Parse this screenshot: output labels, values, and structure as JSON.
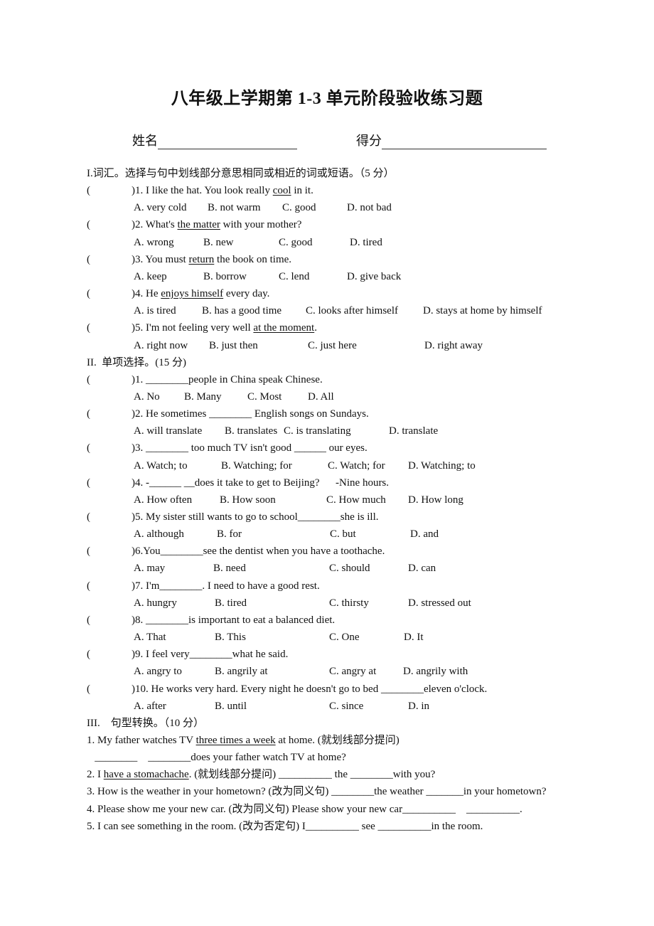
{
  "title": "八年级上学期第 1-3 单元阶段验收练习题",
  "header": {
    "name_label": "姓名",
    "score_label": "得分"
  },
  "section1": {
    "heading": "I.词汇。选择与句中划线部分意思相同或相近的词或短语。（5 分）",
    "questions": [
      {
        "num": ")1. ",
        "pre": "I like the hat. You look really ",
        "u": "cool",
        "post": " in it.",
        "options": [
          "A. very cold",
          "B. not warm",
          "C. good",
          "D. not bad"
        ]
      },
      {
        "num": ")2. ",
        "pre": "What's ",
        "u": "the matter",
        "post": " with your mother?",
        "options": [
          "A. wrong",
          "B. new",
          "C. good",
          "D. tired"
        ]
      },
      {
        "num": ")3. ",
        "pre": "You must ",
        "u": "return",
        "post": " the book on time.",
        "options": [
          "A. keep",
          "B. borrow",
          "C. lend",
          "D. give back"
        ]
      },
      {
        "num": ")4. ",
        "pre": "He ",
        "u": "enjoys himself",
        "post": " every day.",
        "options": [
          "A. is tired",
          "B. has a good time",
          "C. looks after himself",
          "D. stays at home by himself"
        ]
      },
      {
        "num": ")5. ",
        "pre": "I'm not feeling very well ",
        "u": "at the moment",
        "post": ".",
        "options": [
          "A. right now",
          "B. just then",
          "C. just here",
          "D. right away"
        ]
      }
    ]
  },
  "section2": {
    "heading": "II.  单项选择。(15 分)",
    "questions": [
      {
        "text": ")1. ________people in China speak Chinese.",
        "options": [
          "A. No",
          "B. Many",
          "C. Most",
          "D. All"
        ]
      },
      {
        "text": ")2. He sometimes ________ English songs on Sundays.",
        "options": [
          "A. will translate",
          "B. translates",
          "C. is translating",
          "D. translate"
        ]
      },
      {
        "text": ")3. ________ too much TV isn't good ______ our eyes.",
        "options": [
          "A. Watch; to",
          "B. Watching; for",
          "C. Watch; for",
          "D. Watching; to"
        ]
      },
      {
        "text": ")4. -______ __does it take to get to Beijing?      -Nine hours.",
        "options": [
          "A. How often",
          "B. How soon",
          "C. How much",
          "D. How long"
        ]
      },
      {
        "text": ")5. My sister still wants to go to school________she is ill.",
        "options": [
          "A. although",
          "B. for",
          "C. but",
          "D. and"
        ]
      },
      {
        "text": ")6.You________see the dentist when you have a toothache.",
        "options": [
          "A. may",
          "B. need",
          "C. should",
          "D. can"
        ]
      },
      {
        "text": ")7. I'm________. I need to have a good rest.",
        "options": [
          "A. hungry",
          "B. tired",
          "C. thirsty",
          "D. stressed out"
        ]
      },
      {
        "text": ")8. ________is important to eat a balanced diet.",
        "options": [
          "A. That",
          "B. This",
          "C. One",
          "D. It"
        ]
      },
      {
        "text": ")9. I feel very________what he said.",
        "options": [
          "A. angry to",
          "B. angrily at",
          "C. angry at",
          "D. angrily with"
        ]
      },
      {
        "text": ")10. He works very hard. Every night he doesn't go to bed ________eleven o'clock.",
        "options": [
          "A. after",
          "B. until",
          "C. since",
          "D. in"
        ]
      }
    ]
  },
  "section3": {
    "heading": "III.    句型转换。（10 分）",
    "items": [
      {
        "pre": "1. My father watches TV ",
        "u": "three times a week",
        "post": " at home. (就划线部分提问)"
      },
      {
        "pre": "   ________    ________does your father watch TV at home?",
        "u": "",
        "post": ""
      },
      {
        "pre": "2. I ",
        "u": "have a stomachache",
        "post": ". (就划线部分提问) __________ the ________with you?"
      },
      {
        "pre": "3. How is the weather in your hometown? (改为同义句) ________the weather _______in your hometown?",
        "u": "",
        "post": ""
      },
      {
        "pre": "4. Please show me your new car. (改为同义句) Please show your new car__________    __________.",
        "u": "",
        "post": ""
      },
      {
        "pre": "5. I can see something in the room. (改为否定句) I__________ see __________in the room.",
        "u": "",
        "post": ""
      }
    ]
  }
}
